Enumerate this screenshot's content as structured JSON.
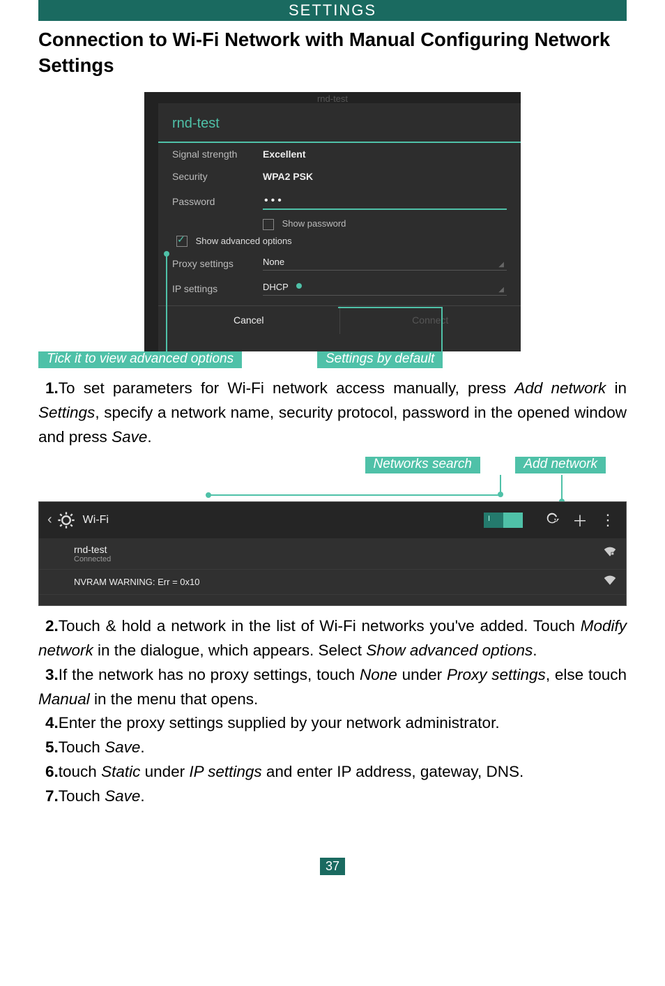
{
  "header": "SETTINGS",
  "title": "Connection to Wi-Fi Network with Manual Configuring Network Settings",
  "dialog": {
    "partial_title": "rnd-test",
    "network_name": "rnd-test",
    "signal_label": "Signal strength",
    "signal_value": "Excellent",
    "security_label": "Security",
    "security_value": "WPA2 PSK",
    "password_label": "Password",
    "password_value": "•••",
    "show_password": "Show password",
    "show_advanced": "Show advanced options",
    "proxy_label": "Proxy settings",
    "proxy_value": "None",
    "ip_label": "IP settings",
    "ip_value": "DHCP",
    "cancel": "Cancel",
    "connect": "Connect"
  },
  "callout1_left": "Tick it to view advanced options",
  "callout1_right": "Settings by default",
  "para1_num": "1.",
  "para1_a": "To set parameters for Wi-Fi network access manually, press ",
  "para1_i1": "Add network",
  "para1_b": " in ",
  "para1_i2": "Settings",
  "para1_c": ", specify a network name, security protocol, password in the opened window and press ",
  "para1_i3": "Save",
  "para1_d": ".",
  "callout2_left": "Networks search",
  "callout2_right": "Add network",
  "wifi_bar": {
    "title": "Wi-Fi",
    "switch": "I",
    "net1_name": "rnd-test",
    "net1_sub": "Connected",
    "net2_name": "NVRAM WARNING: Err = 0x10"
  },
  "p2_num": "2.",
  "p2_a": "Touch & hold a network in the list of Wi-Fi networks you've added. Touch ",
  "p2_i1": "Modify network",
  "p2_b": " in the dialogue, which appears. Select ",
  "p2_i2": "Show advanced options",
  "p2_c": ".",
  "p3_num": "3.",
  "p3_a": "If the network has no proxy settings, touch ",
  "p3_i1": "None",
  "p3_b": " under ",
  "p3_i2": "Proxy settings",
  "p3_c": ", else touch ",
  "p3_i3": "Manual",
  "p3_d": " in the menu that opens.",
  "p4_num": "4.",
  "p4_a": "Enter the proxy settings supplied by your network administrator.",
  "p5_num": "5.",
  "p5_a": "Touch ",
  "p5_i1": "Save",
  "p5_b": ".",
  "p6_num": "6.",
  "p6_a": "touch ",
  "p6_i1": "Static",
  "p6_b": " under ",
  "p6_i2": "IP settings",
  "p6_c": " and enter IP address, gateway, DNS.",
  "p7_num": "7.",
  "p7_a": "Touch ",
  "p7_i1": "Save",
  "p7_b": ".",
  "page_number": "37"
}
